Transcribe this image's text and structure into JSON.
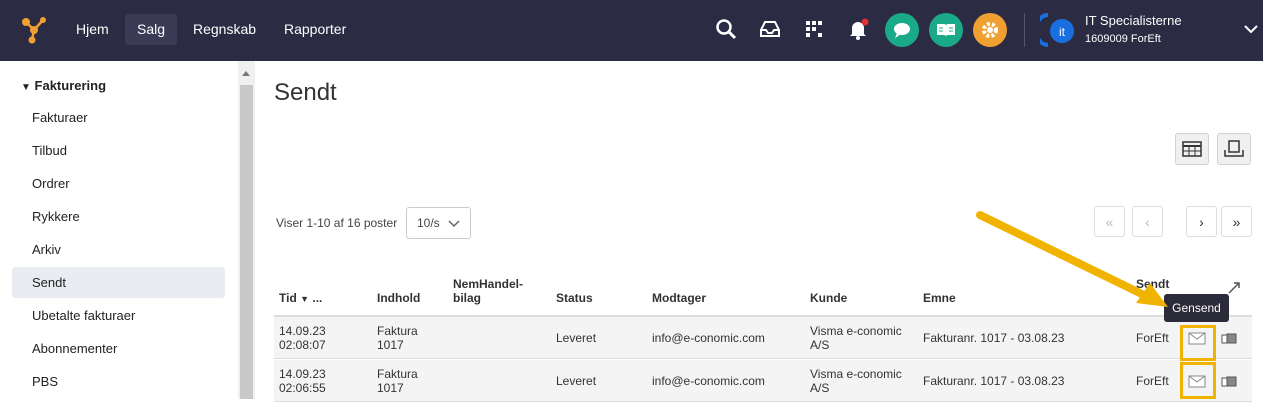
{
  "topnav": {
    "items": [
      "Hjem",
      "Salg",
      "Regnskab",
      "Rapporter"
    ],
    "active": "Salg"
  },
  "company": {
    "name": "IT Specialisterne",
    "sub": "1609009 ForEft",
    "logo_text": "it"
  },
  "colors": {
    "topbar": "#2b2b44",
    "chat": "#1aaa8a",
    "book": "#1aaa8a",
    "settings": "#f0a030",
    "highlight": "#f0b400",
    "selected": "#e9edf2"
  },
  "sidebar": {
    "section": "Fakturering",
    "items": [
      "Fakturaer",
      "Tilbud",
      "Ordrer",
      "Rykkere",
      "Arkiv",
      "Sendt",
      "Ubetalte fakturaer",
      "Abonnementer",
      "PBS"
    ],
    "selected": "Sendt"
  },
  "page": {
    "title": "Sendt"
  },
  "pagination": {
    "count_text": "Viser 1-10 af 16 poster",
    "per_page": "10/s"
  },
  "table": {
    "headers": {
      "tid": "Tid",
      "tid_more": "...",
      "indhold": "Indhold",
      "nemhandel1": "NemHandel-",
      "nemhandel2": "bilag",
      "status": "Status",
      "modtager": "Modtager",
      "kunde": "Kunde",
      "emne": "Emne",
      "sendt": "Sendt"
    },
    "rows": [
      {
        "date": "14.09.23",
        "time": "02:08:07",
        "indhold1": "Faktura",
        "indhold2": "1017",
        "status": "Leveret",
        "modtager": "info@e-conomic.com",
        "kunde1": "Visma e-conomic",
        "kunde2": "A/S",
        "emne": "Fakturanr. 1017 - 03.08.23",
        "sendt": "ForEft"
      },
      {
        "date": "14.09.23",
        "time": "02:06:55",
        "indhold1": "Faktura",
        "indhold2": "1017",
        "status": "Leveret",
        "modtager": "info@e-conomic.com",
        "kunde1": "Visma e-conomic",
        "kunde2": "A/S",
        "emne": "Fakturanr. 1017 - 03.08.23",
        "sendt": "ForEft"
      }
    ]
  },
  "tooltip": {
    "text": "Gensend"
  }
}
